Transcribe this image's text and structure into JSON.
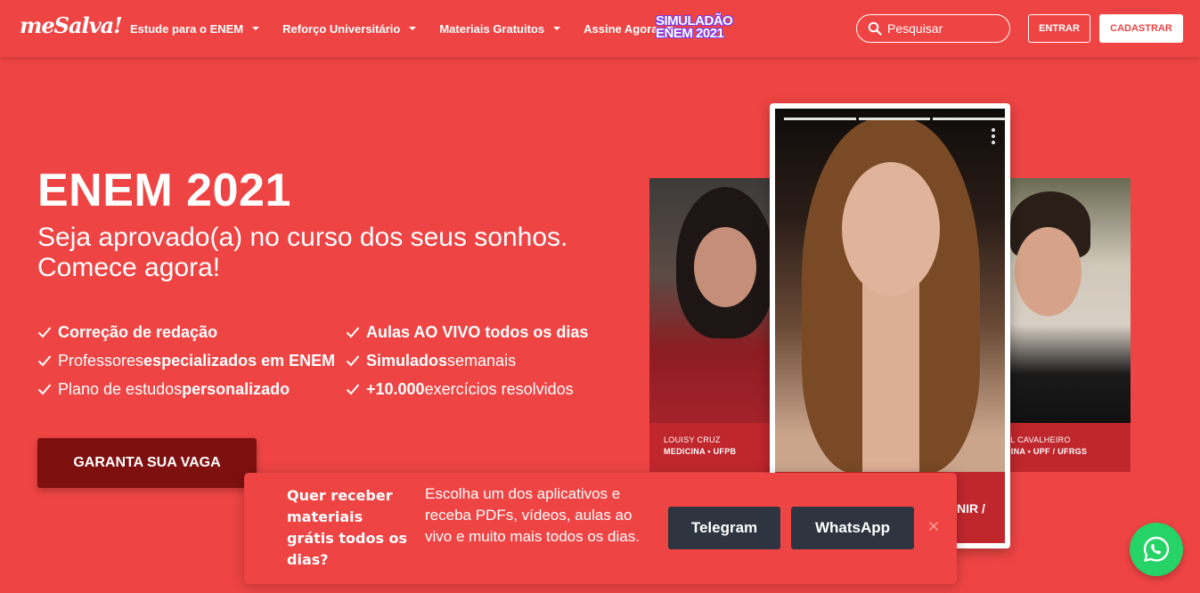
{
  "header": {
    "logo": "meSalva!",
    "nav": [
      {
        "label": "Estude para o ENEM"
      },
      {
        "label": "Reforço Universitário"
      },
      {
        "label": "Materiais Gratuitos"
      },
      {
        "label": "Assine Agora"
      }
    ],
    "promo_line1": "SIMULADÃO",
    "promo_line2": "ENEM 2021",
    "search_placeholder": "Pesquisar",
    "login_label": "ENTRAR",
    "signup_label": "CADASTRAR"
  },
  "hero": {
    "title": "ENEM 2021",
    "subtitle": "Seja aprovado(a) no curso dos seus sonhos. Comece agora!",
    "features": [
      {
        "pre": "",
        "bold": "Correção de redação",
        "post": ""
      },
      {
        "pre": "",
        "bold": "Aulas AO VIVO todos os dias",
        "post": ""
      },
      {
        "pre": "Professores ",
        "bold": "especializados em ENEM",
        "post": ""
      },
      {
        "pre": "",
        "bold": "Simulados",
        "post": " semanais"
      },
      {
        "pre": "Plano de estudos ",
        "bold": "personalizado",
        "post": ""
      },
      {
        "pre": "",
        "bold": "+10.000",
        "post": " exercícios resolvidos"
      }
    ],
    "cta_label": "GARANTA SUA VAGA"
  },
  "carousel": {
    "left_name": "LOUISY CRUZ",
    "left_course": "MEDICINA • UFPB",
    "right_name": "EL CAVALHEIRO",
    "right_course": "CINA • UPF / UFRGS",
    "main_caption": "NIR /"
  },
  "popup": {
    "title": "Quer receber materiais grátis todos os dias?",
    "text": "Escolha um dos aplicativos e receba PDFs, vídeos, aulas ao vivo e muito mais todos os dias.",
    "telegram_label": "Telegram",
    "whatsapp_label": "WhatsApp"
  },
  "colors": {
    "brand": "#ef4444",
    "cta": "#7f1010",
    "popup_buttons": "#2f3540",
    "whatsapp": "#25d366"
  }
}
